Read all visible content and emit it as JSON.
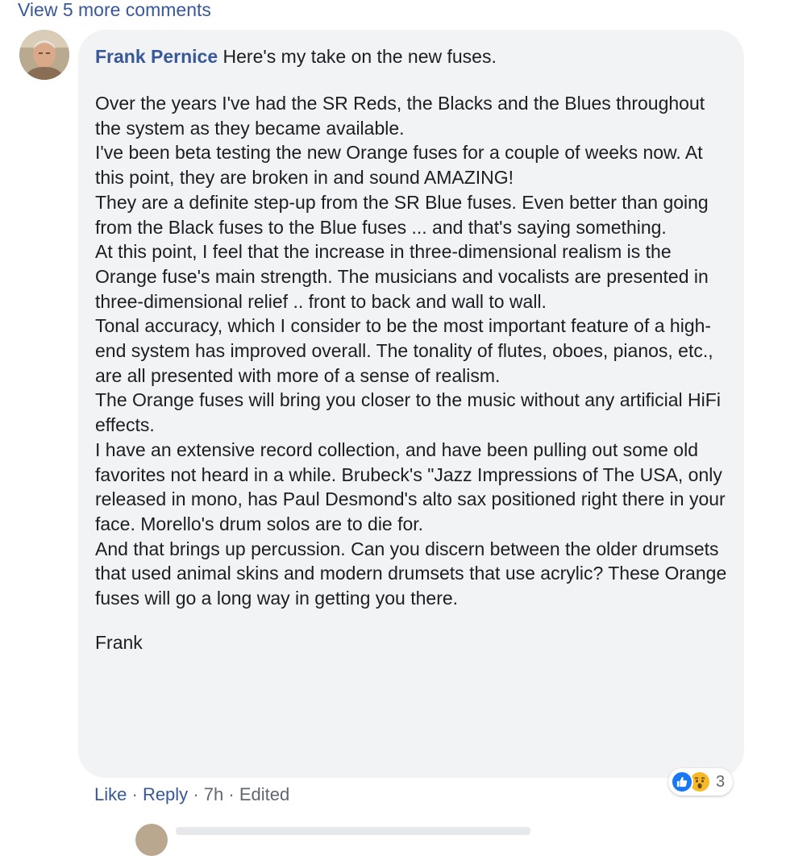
{
  "view_more": "View 5 more comments",
  "comment": {
    "author": "Frank Pernice",
    "intro": "Here's my take on the new fuses.",
    "paragraphs": [
      "Over the years I've had the SR Reds, the Blacks and the Blues throughout the system as they became available.",
      "I've been beta testing the new Orange fuses for a couple of weeks now. At this point, they are broken in and sound AMAZING!",
      "They are a definite step-up from the SR Blue fuses. Even better than going from the Black fuses to the Blue fuses ... and that's saying something.",
      "At this point, I feel that the increase in three-dimensional realism is the Orange fuse's main strength. The musicians and vocalists are presented in three-dimensional relief .. front to back and wall to wall.",
      "Tonal accuracy, which I consider to be the most important feature of a high-end system has improved overall. The tonality of flutes, oboes, pianos, etc., are all presented with more of a sense of realism.",
      "The Orange fuses will bring you closer to the music without any artificial HiFi effects.",
      "I have an extensive record collection, and have been pulling out some old favorites not heard in a while. Brubeck's \"Jazz Impressions of The USA, only released in mono, has Paul Desmond's alto sax positioned right there in your face. Morello's drum solos are to die for.",
      "And that brings up percussion. Can you discern between the older drumsets that used animal skins and modern drumsets that use acrylic? These Orange fuses will go a long way in getting you there."
    ],
    "signoff": "Frank"
  },
  "actions": {
    "like": "Like",
    "reply": "Reply",
    "time": "7h",
    "edited": "Edited",
    "separator": "·"
  },
  "reactions": {
    "count": "3",
    "icons": [
      "like-icon",
      "wow-icon"
    ],
    "like_color": "#1877f2",
    "wow_color": "#f7b928"
  },
  "colors": {
    "link": "#385898",
    "bubble": "#f2f3f5",
    "meta": "#606770"
  }
}
